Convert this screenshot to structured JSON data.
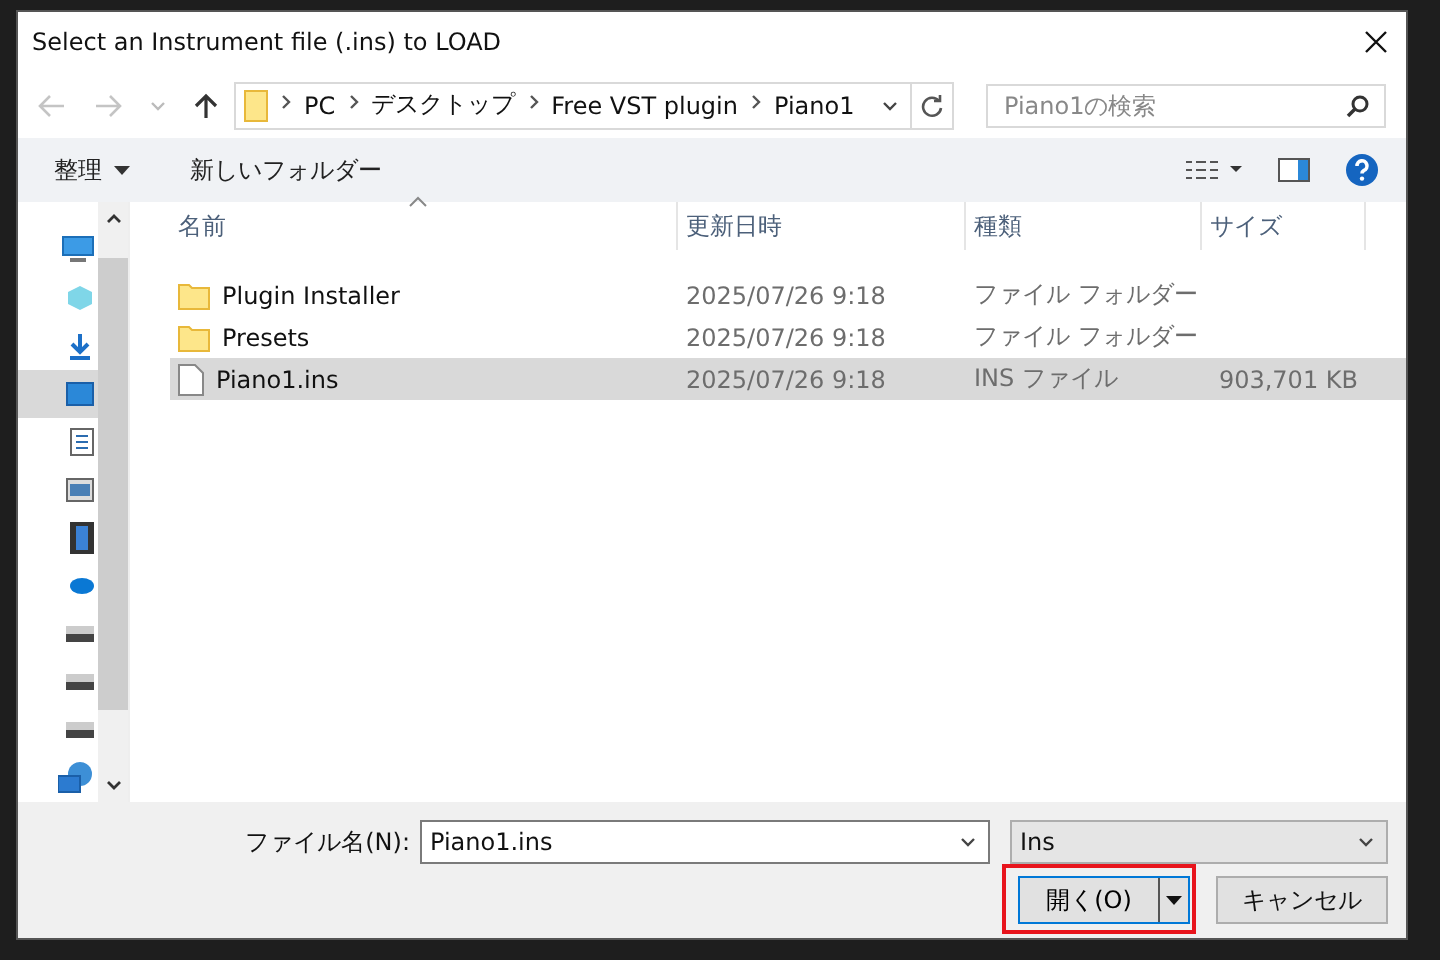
{
  "window": {
    "title": "Select an Instrument file (.ins) to LOAD"
  },
  "address_bar": {
    "path": [
      {
        "label": "PC"
      },
      {
        "label": "デスクトップ"
      },
      {
        "label": "Free VST plugin"
      },
      {
        "label": "Piano1"
      }
    ]
  },
  "search": {
    "placeholder": "Piano1の検索"
  },
  "toolbar": {
    "organize": "整理",
    "new_folder": "新しいフォルダー"
  },
  "nav_pane": {
    "items": [
      {
        "kind": "pc",
        "selected": false
      },
      {
        "kind": "cube",
        "selected": false
      },
      {
        "kind": "download",
        "selected": false
      },
      {
        "kind": "desktop",
        "selected": true
      },
      {
        "kind": "document",
        "selected": false
      },
      {
        "kind": "picture",
        "selected": false
      },
      {
        "kind": "video",
        "selected": false
      },
      {
        "kind": "cloud",
        "selected": false
      },
      {
        "kind": "drive",
        "selected": false
      },
      {
        "kind": "drive",
        "selected": false
      },
      {
        "kind": "drive",
        "selected": false
      },
      {
        "kind": "network",
        "selected": false
      }
    ]
  },
  "table": {
    "columns": [
      "名前",
      "更新日時",
      "種類",
      "サイズ"
    ],
    "rows": [
      {
        "kind": "folder",
        "name": "Plugin Installer",
        "modified": "2025/07/26 9:18",
        "type": "ファイル フォルダー",
        "size": null,
        "selected": false
      },
      {
        "kind": "folder",
        "name": "Presets",
        "modified": "2025/07/26 9:18",
        "type": "ファイル フォルダー",
        "size": null,
        "selected": false
      },
      {
        "kind": "file",
        "name": "Piano1.ins",
        "modified": "2025/07/26 9:18",
        "type": "INS ファイル",
        "size": "903,701 KB",
        "selected": true
      }
    ]
  },
  "footer": {
    "filename_label": "ファイル名(N):",
    "filename": "Piano1.ins",
    "filter": "Ins",
    "open_button": "開く(O)",
    "cancel_button": "キャンセル"
  }
}
